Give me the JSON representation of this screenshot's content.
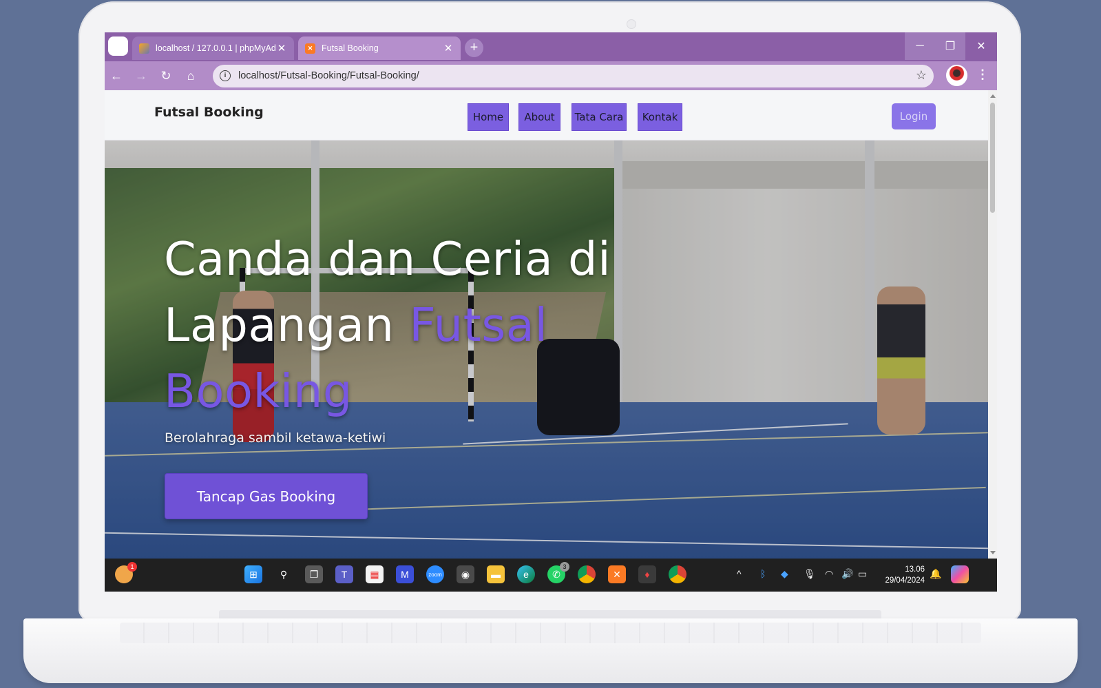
{
  "browser": {
    "tabs": [
      {
        "title": "localhost / 127.0.0.1 | phpMyAd"
      },
      {
        "title": "Futsal Booking"
      }
    ],
    "url": "localhost/Futsal-Booking/Futsal-Booking/"
  },
  "site": {
    "brand": "Futsal Booking",
    "nav": [
      "Home",
      "About",
      "Tata Cara",
      "Kontak"
    ],
    "login": "Login"
  },
  "hero": {
    "title_line1": "Canda dan Ceria di",
    "title_line2": "Lapangan ",
    "title_accent1": "Futsal",
    "title_accent2": "Booking",
    "subtitle": "Berolahraga sambil ketawa-ketiwi",
    "cta": "Tancap Gas Booking",
    "accent_color": "#7857e3"
  },
  "taskbar": {
    "widgets_badge": "1",
    "whatsapp_badge": "3",
    "time": "13.06",
    "date": "29/04/2024"
  }
}
